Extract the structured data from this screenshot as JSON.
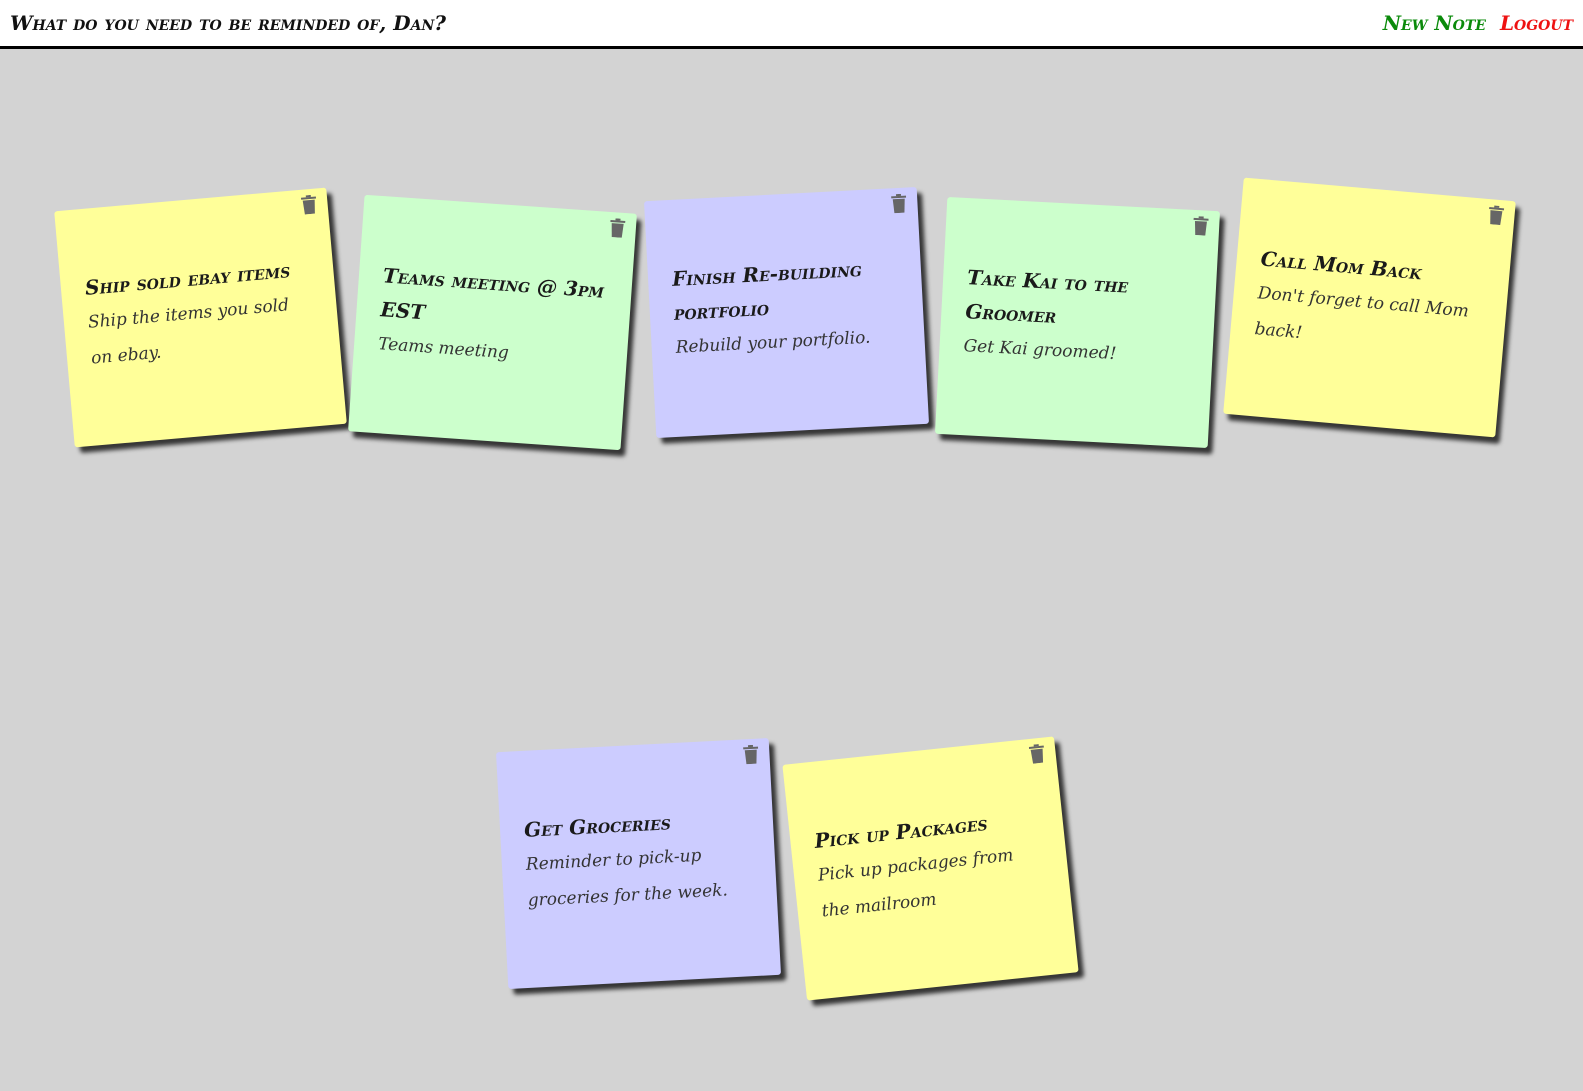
{
  "header": {
    "greeting": "What do you need to be reminded of, Dan?",
    "new_note_label": "New Note",
    "logout_label": "Logout",
    "new_note_color": "#0a8a0a",
    "logout_color": "#ee1111"
  },
  "colors": {
    "background": "#d3d3d3",
    "yellow": "#ffff99",
    "green": "#ccffcc",
    "purple": "#ccccff"
  },
  "notes": [
    {
      "title": "Ship sold ebay items",
      "body": "Ship the items you sold on ebay.",
      "color": "yellow"
    },
    {
      "title": "Teams meeting @ 3pm EST",
      "body": "Teams meeting",
      "color": "green"
    },
    {
      "title": "Finish Re-building portfolio",
      "body": "Rebuild your portfolio.",
      "color": "purple"
    },
    {
      "title": "Take Kai to the Groomer",
      "body": "Get Kai groomed!",
      "color": "green"
    },
    {
      "title": "Call Mom Back",
      "body": "Don't forget to call Mom back!",
      "color": "yellow"
    },
    {
      "title": "Get Groceries",
      "body": "Reminder to pick-up groceries for the week.",
      "color": "purple"
    },
    {
      "title": "Pick up Packages",
      "body": "Pick up packages from the mailroom",
      "color": "yellow"
    }
  ],
  "icons": {
    "delete": "trash-icon"
  }
}
